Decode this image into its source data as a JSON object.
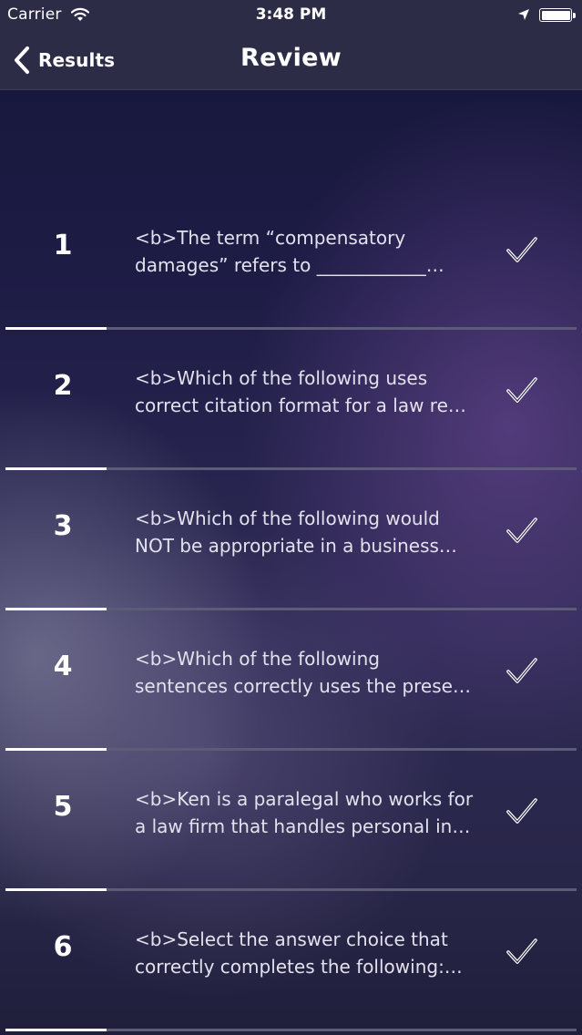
{
  "status_bar": {
    "carrier": "Carrier",
    "time": "3:48 PM",
    "wifi_icon": "wifi-icon",
    "location_icon": "location-arrow-icon",
    "battery_icon": "battery-icon",
    "battery_level": 1.0
  },
  "nav": {
    "back_label": "Results",
    "back_icon": "chevron-left-icon",
    "title": "Review"
  },
  "questions": [
    {
      "number": "1",
      "line1": "<b>The term “compensatory",
      "line2": "damages” refers to ____________…",
      "status_icon": "checkmark-icon"
    },
    {
      "number": "2",
      "line1": "<b>Which of the following uses",
      "line2": "correct citation format for a law re…",
      "status_icon": "checkmark-icon"
    },
    {
      "number": "3",
      "line1": "<b>Which of the following would",
      "line2": "NOT be appropriate in a business…",
      "status_icon": "checkmark-icon"
    },
    {
      "number": "4",
      "line1": "<b>Which of the following",
      "line2": "sentences correctly uses the prese…",
      "status_icon": "checkmark-icon"
    },
    {
      "number": "5",
      "line1": "<b>Ken is a paralegal who works for",
      "line2": "a law firm that handles personal in…",
      "status_icon": "checkmark-icon"
    },
    {
      "number": "6",
      "line1": "<b>Select the answer choice that",
      "line2": "correctly completes the following:…",
      "status_icon": "checkmark-icon"
    }
  ]
}
